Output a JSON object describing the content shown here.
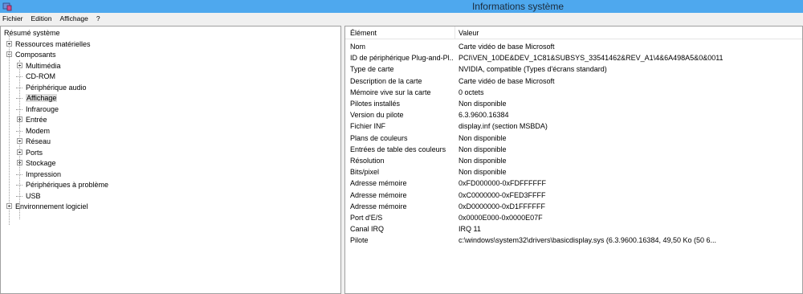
{
  "window": {
    "title": "Informations système"
  },
  "menu": [
    "Fichier",
    "Edition",
    "Affichage",
    "?"
  ],
  "tree": {
    "root": "Résumé système",
    "items": [
      {
        "label": "Ressources matérielles",
        "depth": 1,
        "expander": "plus"
      },
      {
        "label": "Composants",
        "depth": 1,
        "expander": "minus"
      },
      {
        "label": "Multimédia",
        "depth": 2,
        "expander": "plus"
      },
      {
        "label": "CD-ROM",
        "depth": 2,
        "expander": ""
      },
      {
        "label": "Périphérique audio",
        "depth": 2,
        "expander": ""
      },
      {
        "label": "Affichage",
        "depth": 2,
        "expander": "",
        "selected": true
      },
      {
        "label": "Infrarouge",
        "depth": 2,
        "expander": ""
      },
      {
        "label": "Entrée",
        "depth": 2,
        "expander": "plus"
      },
      {
        "label": "Modem",
        "depth": 2,
        "expander": ""
      },
      {
        "label": "Réseau",
        "depth": 2,
        "expander": "plus"
      },
      {
        "label": "Ports",
        "depth": 2,
        "expander": "plus"
      },
      {
        "label": "Stockage",
        "depth": 2,
        "expander": "plus"
      },
      {
        "label": "Impression",
        "depth": 2,
        "expander": ""
      },
      {
        "label": "Périphériques à problème",
        "depth": 2,
        "expander": ""
      },
      {
        "label": "USB",
        "depth": 2,
        "expander": ""
      },
      {
        "label": "Environnement logiciel",
        "depth": 1,
        "expander": "plus"
      }
    ]
  },
  "list": {
    "columns": [
      "Élément",
      "Valeur"
    ],
    "rows": [
      [
        "Nom",
        "Carte vidéo de base Microsoft"
      ],
      [
        "ID de périphérique Plug-and-Pl...",
        "PCI\\VEN_10DE&DEV_1C81&SUBSYS_33541462&REV_A1\\4&6A498A5&0&0011"
      ],
      [
        "Type de carte",
        "NVIDIA, compatible (Types d'écrans standard)"
      ],
      [
        "Description de la carte",
        "Carte vidéo de base Microsoft"
      ],
      [
        "Mémoire vive sur la carte",
        "0 octets"
      ],
      [
        "Pilotes installés",
        "Non disponible"
      ],
      [
        "Version du pilote",
        "6.3.9600.16384"
      ],
      [
        "Fichier INF",
        "display.inf (section MSBDA)"
      ],
      [
        "Plans de couleurs",
        "Non disponible"
      ],
      [
        "Entrées de table des couleurs",
        "Non disponible"
      ],
      [
        "Résolution",
        "Non disponible"
      ],
      [
        "Bits/pixel",
        "Non disponible"
      ],
      [
        "Adresse mémoire",
        "0xFD000000-0xFDFFFFFF"
      ],
      [
        "Adresse mémoire",
        "0xC0000000-0xFED3FFFF"
      ],
      [
        "Adresse mémoire",
        "0xD0000000-0xD1FFFFFF"
      ],
      [
        "Port d'E/S",
        "0x0000E000-0x0000E07F"
      ],
      [
        "Canal IRQ",
        "IRQ 11"
      ],
      [
        "Pilote",
        "c:\\windows\\system32\\drivers\\basicdisplay.sys (6.3.9600.16384, 49,50 Ko (50 6..."
      ]
    ]
  }
}
